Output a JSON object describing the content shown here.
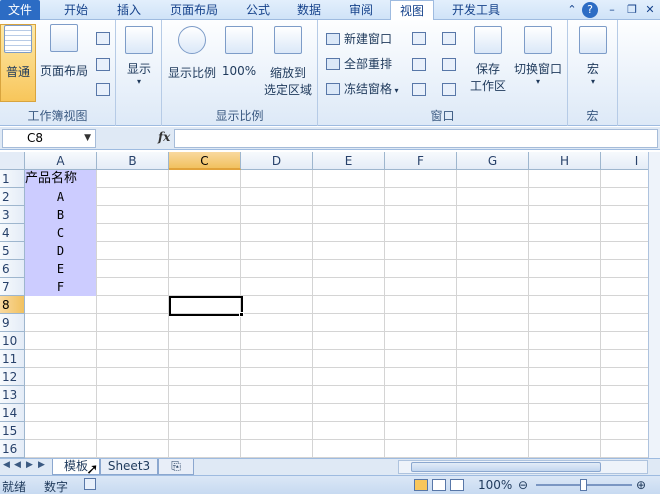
{
  "ribbon_tabs": [
    "文件",
    "开始",
    "插入",
    "页面布局",
    "公式",
    "数据",
    "审阅",
    "视图",
    "开发工具"
  ],
  "ribbon": {
    "workbook_views": {
      "normal": "普通",
      "page_layout": "页面布局",
      "group_label": "工作簿视图"
    },
    "show": {
      "label": "显示"
    },
    "zoom": {
      "zoom": "显示比例",
      "hundred": "100%",
      "zoom_to_selection_1": "缩放到",
      "zoom_to_selection_2": "选定区域",
      "group_label": "显示比例"
    },
    "window": {
      "new_window": "新建窗口",
      "arrange_all": "全部重排",
      "freeze_panes": "冻结窗格",
      "save_workspace_1": "保存",
      "save_workspace_2": "工作区",
      "switch_windows": "切换窗口",
      "group_label": "窗口"
    },
    "macros": {
      "label": "宏",
      "group_label": "宏"
    }
  },
  "formula_bar": {
    "name_box": "C8",
    "fx": "fx",
    "value": ""
  },
  "columns": [
    "A",
    "B",
    "C",
    "D",
    "E",
    "F",
    "G",
    "H",
    "I"
  ],
  "rows": [
    "1",
    "2",
    "3",
    "4",
    "5",
    "6",
    "7",
    "8",
    "9",
    "10",
    "11",
    "12",
    "13",
    "14",
    "15",
    "16"
  ],
  "cells": {
    "A1": "产品名称",
    "A2": "A",
    "A3": "B",
    "A4": "C",
    "A5": "D",
    "A6": "E",
    "A7": "F"
  },
  "sheet_tabs": [
    "模板",
    "Sheet3"
  ],
  "status": {
    "ready": "就绪",
    "num": "数字",
    "zoom": "100%"
  },
  "colors": {
    "selected_fill": "#ccccff",
    "header_highlight": "#f1c15f",
    "file_tab": "#2c6cc4"
  }
}
